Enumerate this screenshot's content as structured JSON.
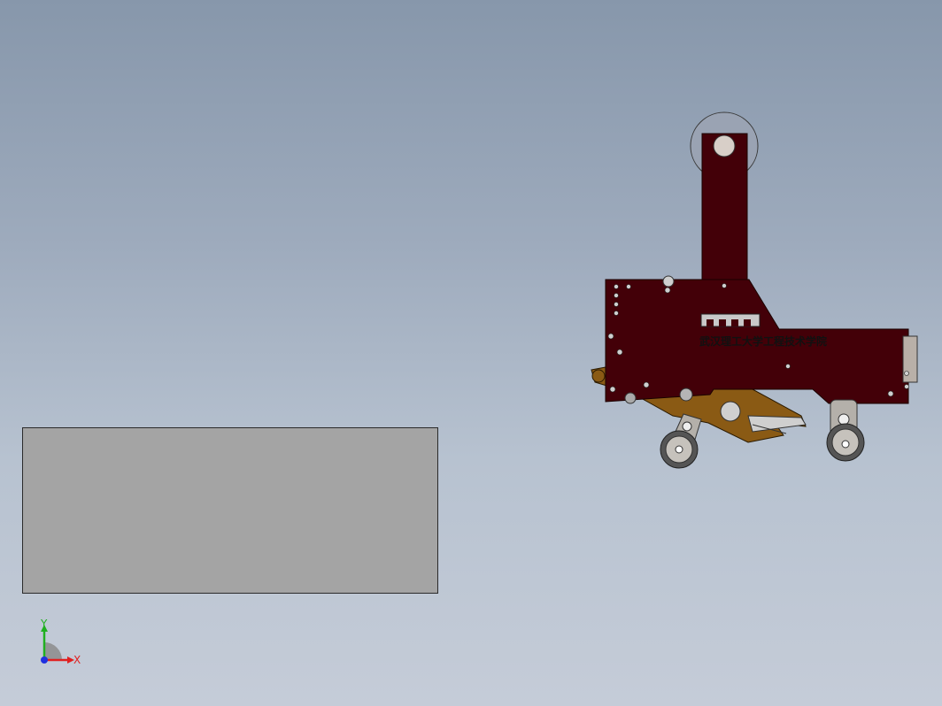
{
  "model": {
    "plate_label": "武汉理工大学工程技术学院"
  },
  "triad": {
    "x_label": "X",
    "y_label": "Y",
    "x_color": "#e02020",
    "y_color": "#20b020",
    "z_color": "#2030e0"
  },
  "colors": {
    "background_top": "#8797ab",
    "background_bottom": "#c5ccd8",
    "plate": "#430008",
    "bracket": "#8a5a14",
    "panel": "#a4a4a4"
  }
}
